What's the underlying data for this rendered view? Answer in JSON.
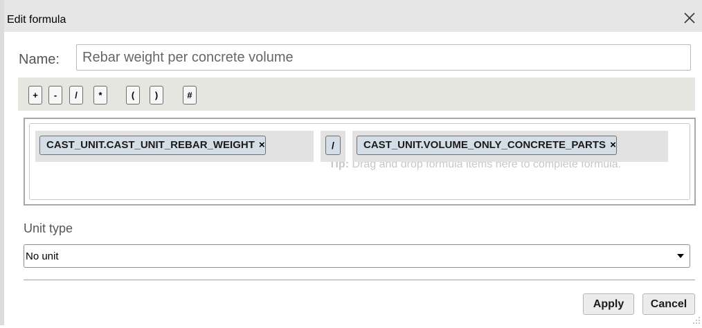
{
  "window": {
    "title": "Edit formula",
    "close_icon": "close-icon"
  },
  "name": {
    "label": "Name:",
    "value": "Rebar weight per concrete volume"
  },
  "operators": [
    "+",
    "-",
    "/",
    "*",
    "(",
    ")",
    "#"
  ],
  "formula": {
    "tip_bold": "Tip:",
    "tip_text": " Drag and drop formula items here to complete formula.",
    "items": [
      {
        "label": "CAST_UNIT.CAST_UNIT_REBAR_WEIGHT",
        "remove": "×"
      },
      {
        "label": "/"
      },
      {
        "label": "CAST_UNIT.VOLUME_ONLY_CONCRETE_PARTS",
        "remove": "×"
      }
    ]
  },
  "unit": {
    "label": "Unit type",
    "selected": "No unit"
  },
  "footer": {
    "apply_label": "Apply",
    "cancel_label": "Cancel"
  },
  "colors": {
    "titlebar": "#e6e6e6",
    "chip_bg": "#d5dde7",
    "tip_text": "#c7c7c7"
  }
}
